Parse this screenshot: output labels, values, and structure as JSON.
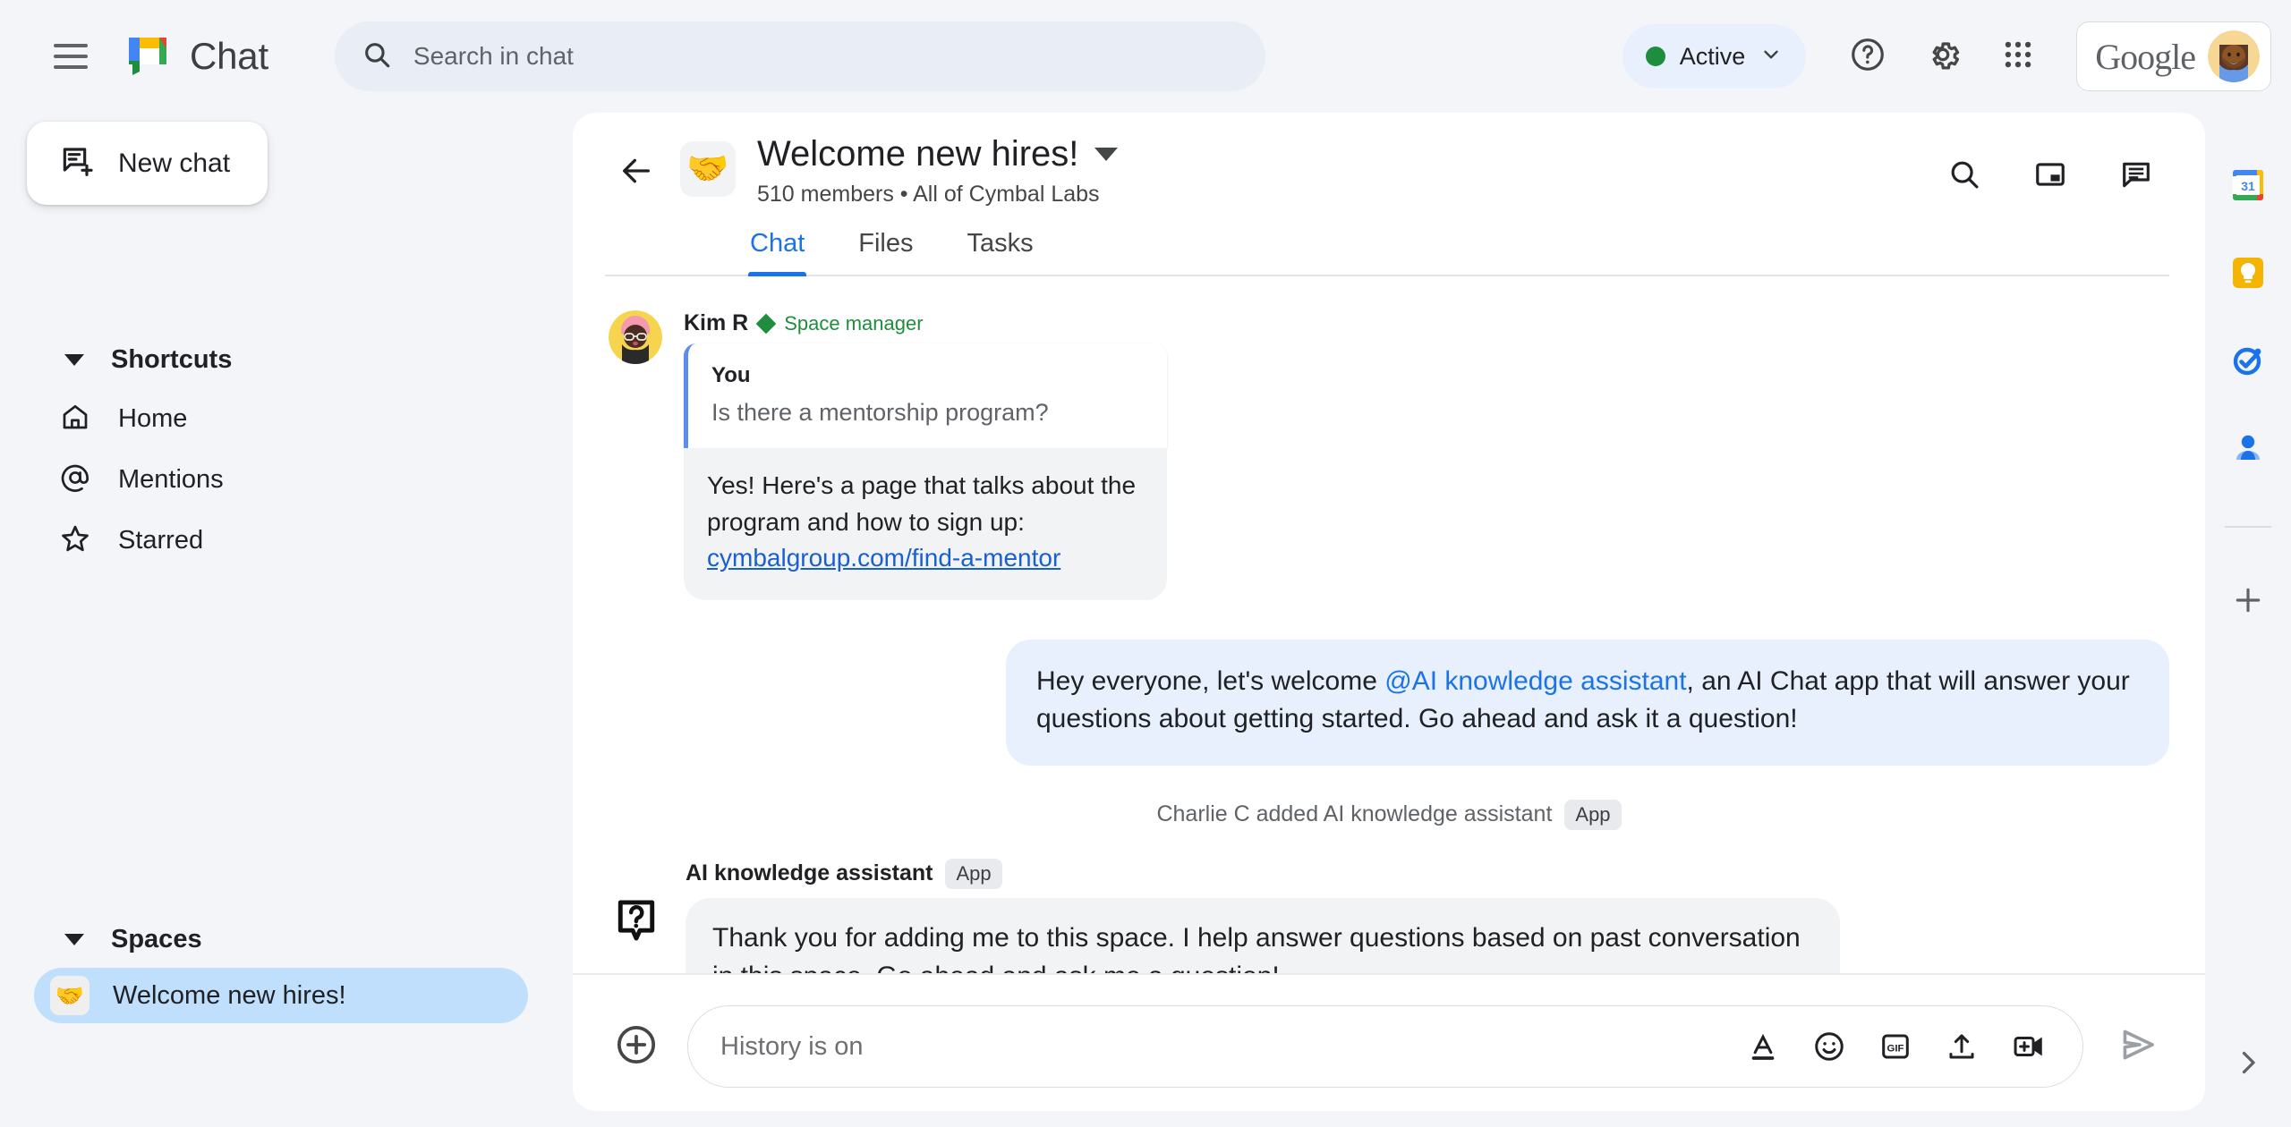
{
  "topbar": {
    "menu_icon": "hamburger-menu-icon",
    "app_name": "Chat",
    "search": {
      "placeholder": "Search in chat",
      "icon": "search-icon"
    },
    "status": {
      "label": "Active",
      "color": "#1e8e3e",
      "chevron": "chevron-down-icon"
    },
    "help_icon": "help-circle-icon",
    "settings_icon": "gear-icon",
    "apps_icon": "apps-grid-icon",
    "google_label": "Google",
    "avatar_icon": "user-avatar"
  },
  "sidebar": {
    "new_chat": {
      "label": "New chat",
      "icon": "new-chat-icon"
    },
    "shortcuts": {
      "title": "Shortcuts",
      "items": [
        {
          "label": "Home",
          "icon": "home-icon"
        },
        {
          "label": "Mentions",
          "icon": "at-mention-icon"
        },
        {
          "label": "Starred",
          "icon": "star-icon"
        }
      ]
    },
    "spaces": {
      "title": "Spaces",
      "items": [
        {
          "label": "Welcome new hires!",
          "emoji": "🤝",
          "selected": true
        }
      ]
    }
  },
  "space_header": {
    "back_icon": "back-arrow-icon",
    "emoji": "🤝",
    "title": "Welcome new hires!",
    "title_chevron": "chevron-down-icon",
    "members": "510 members",
    "separator": "•",
    "org": "All of Cymbal Labs",
    "subtitle": "510 members  •  All of Cymbal Labs",
    "actions": [
      {
        "icon": "search-icon",
        "name": "search-in-space"
      },
      {
        "icon": "picture-in-picture-icon",
        "name": "open-in-pip"
      },
      {
        "icon": "chat-bubble-icon",
        "name": "toggle-thread-panel"
      }
    ],
    "tabs": [
      {
        "label": "Chat",
        "active": true
      },
      {
        "label": "Files",
        "active": false
      },
      {
        "label": "Tasks",
        "active": false
      }
    ]
  },
  "messages": {
    "thread": {
      "author": "Kim R",
      "role_badge": "Space manager",
      "quote": {
        "who": "You",
        "text": "Is there a mentorship program?"
      },
      "reply_text": "Yes! Here's a page that talks about the program and how to sign up:",
      "reply_link": "cymbalgroup.com/find-a-mentor"
    },
    "welcome_bubble": {
      "pre": "Hey everyone, let's welcome ",
      "mention": "@AI knowledge assistant",
      "post": ", an AI Chat app that will answer your questions about getting started.  Go ahead and ask it a question!"
    },
    "system_event": {
      "text": "Charlie C added AI knowledge assistant",
      "chip": "App"
    },
    "ai_message": {
      "name": "AI knowledge assistant",
      "chip": "App",
      "icon": "question-bubble-icon",
      "text": "Thank you for adding me to this space. I help answer questions based on past conversation in this space. Go ahead and ask me a question!"
    }
  },
  "composer": {
    "add_icon": "plus-circle-icon",
    "placeholder": "History is on",
    "tools": [
      {
        "icon": "format-text-icon",
        "name": "format-text-button"
      },
      {
        "icon": "emoji-icon",
        "name": "emoji-button"
      },
      {
        "icon": "gif-icon",
        "name": "gif-button",
        "label": "GIF"
      },
      {
        "icon": "upload-icon",
        "name": "upload-file-button"
      },
      {
        "icon": "video-add-icon",
        "name": "add-video-meeting-button"
      }
    ],
    "send_icon": "send-icon"
  },
  "right_rail": {
    "items": [
      {
        "name": "google-calendar",
        "icon": "calendar-icon",
        "day": "31"
      },
      {
        "name": "google-keep",
        "icon": "keep-bulb-icon"
      },
      {
        "name": "google-tasks",
        "icon": "tasks-check-icon"
      },
      {
        "name": "google-contacts",
        "icon": "contacts-person-icon"
      }
    ],
    "add_icon": "plus-icon",
    "expand_icon": "chevron-right-icon"
  },
  "colors": {
    "accent_blue": "#1a73e8",
    "page_bg": "#f4f5f9",
    "panel_bg": "#ffffff",
    "selected_space": "#bfdffc",
    "bubble_blue": "#e8f0fe",
    "bubble_gray": "#f1f3f4",
    "status_green": "#1e8e3e"
  }
}
